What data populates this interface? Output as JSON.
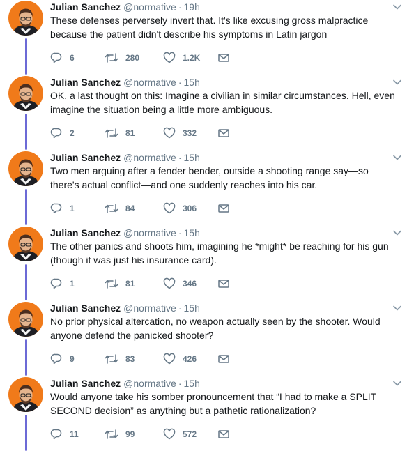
{
  "colors": {
    "thread_line": "#6c6ad6",
    "name": "#14171a",
    "meta": "#657786",
    "avatar_bg": "#f07a1a"
  },
  "icons": {
    "reply": "reply-icon",
    "retweet": "retweet-icon",
    "like": "heart-icon",
    "dm": "envelope-icon",
    "menu": "chevron-down-icon"
  },
  "tweets": [
    {
      "name": "Julian Sanchez",
      "handle": "@normative",
      "time": "19h",
      "text": "These defenses perversely invert that. It's like excusing gross malpractice\nbecause the patient didn't describe his symptoms in Latin jargon",
      "replies": "6",
      "retweets": "280",
      "likes": "1.2K"
    },
    {
      "name": "Julian Sanchez",
      "handle": "@normative",
      "time": "15h",
      "text": "OK, a last thought on this: Imagine a civilian in similar circumstances.  Hell, even\nimagine the situation being a little more ambiguous.",
      "replies": "2",
      "retweets": "81",
      "likes": "332"
    },
    {
      "name": "Julian Sanchez",
      "handle": "@normative",
      "time": "15h",
      "text": "Two men arguing after a fender bender, outside a shooting range say—so\nthere's actual conflict—and one suddenly reaches into his car.",
      "replies": "1",
      "retweets": "84",
      "likes": "306"
    },
    {
      "name": "Julian Sanchez",
      "handle": "@normative",
      "time": "15h",
      "text": "The other panics and shoots him, imagining he *might* be reaching for his gun\n(though it was just his insurance card).",
      "replies": "1",
      "retweets": "81",
      "likes": "346"
    },
    {
      "name": "Julian Sanchez",
      "handle": "@normative",
      "time": "15h",
      "text": "No prior physical altercation, no weapon actually seen by the shooter. Would\nanyone defend the panicked shooter?",
      "replies": "9",
      "retweets": "83",
      "likes": "426"
    },
    {
      "name": "Julian Sanchez",
      "handle": "@normative",
      "time": "15h",
      "text": "Would anyone take his somber pronouncement that “I had to make a SPLIT\nSECOND decision” as anything but a pathetic rationalization?",
      "replies": "11",
      "retweets": "99",
      "likes": "572"
    }
  ]
}
